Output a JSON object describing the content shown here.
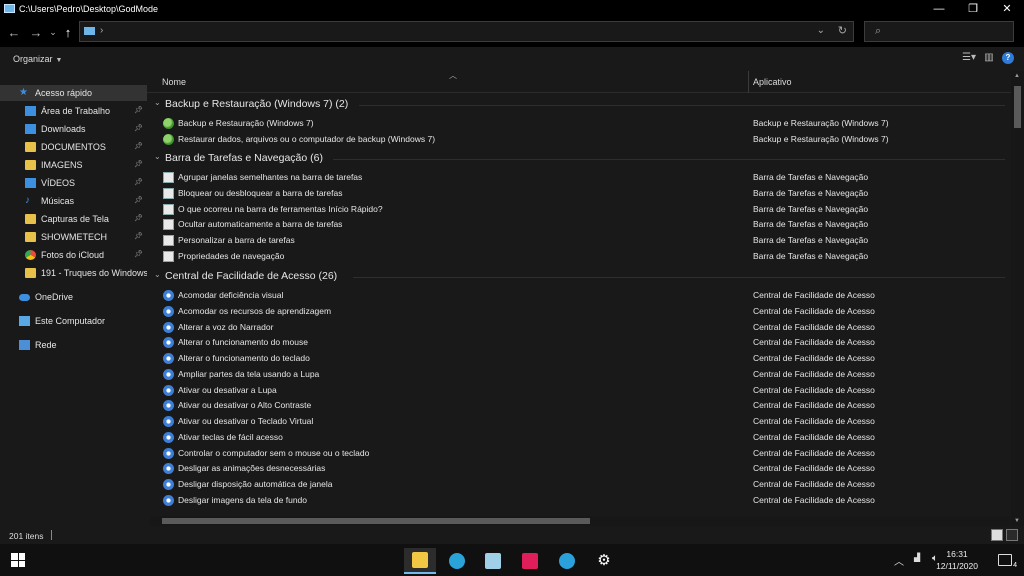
{
  "window": {
    "title": "C:\\Users\\Pedro\\Desktop\\GodMode",
    "minimize": "—",
    "maximize": "❐",
    "close": "✕"
  },
  "nav": {
    "back": "←",
    "forward": "→",
    "recent": "⌄",
    "up": "↑",
    "address_sep": "›",
    "address_dropdown": "⌄",
    "refresh": "↻",
    "search_icon": "⌕"
  },
  "toolbar": {
    "organize": "Organizar"
  },
  "sidebar": {
    "items": [
      {
        "label": "Acesso rápido",
        "icon": "star-icon",
        "pinned": false,
        "selected": true
      },
      {
        "label": "Área de Trabalho",
        "icon": "desktop-icon",
        "pinned": true
      },
      {
        "label": "Downloads",
        "icon": "download-icon",
        "pinned": true
      },
      {
        "label": "DOCUMENTOS",
        "icon": "folder-icon",
        "pinned": true
      },
      {
        "label": "IMAGENS",
        "icon": "folder-icon",
        "pinned": true
      },
      {
        "label": "VÍDEOS",
        "icon": "video-icon",
        "pinned": true
      },
      {
        "label": "Músicas",
        "icon": "music-icon",
        "pinned": true
      },
      {
        "label": "Capturas de Tela",
        "icon": "folder-icon",
        "pinned": true
      },
      {
        "label": "SHOWMETECH",
        "icon": "folder-icon",
        "pinned": true
      },
      {
        "label": "Fotos do iCloud",
        "icon": "chrome-icon",
        "pinned": true
      },
      {
        "label": "191 - Truques do Windows",
        "icon": "folder-icon",
        "pinned": false
      },
      {
        "label": "OneDrive",
        "icon": "cloud-icon",
        "pinned": false
      },
      {
        "label": "Este Computador",
        "icon": "computer-icon",
        "pinned": false
      },
      {
        "label": "Rede",
        "icon": "network-icon",
        "pinned": false
      }
    ]
  },
  "columns": {
    "name": "Nome",
    "app": "Aplicativo"
  },
  "groups": [
    {
      "title": "Backup e Restauração (Windows 7) (2)",
      "icon": "backup-icon",
      "rows": [
        {
          "name": "Backup e Restauração (Windows 7)",
          "app": "Backup e Restauração (Windows 7)"
        },
        {
          "name": "Restaurar dados, arquivos ou o computador de backup (Windows 7)",
          "app": "Backup e Restauração (Windows 7)"
        }
      ]
    },
    {
      "title": "Barra de Tarefas e Navegação (6)",
      "icon": "taskbar-icon",
      "rows": [
        {
          "name": "Agrupar janelas semelhantes na barra de tarefas",
          "app": "Barra de Tarefas e Navegação"
        },
        {
          "name": "Bloquear ou desbloquear a barra de tarefas",
          "app": "Barra de Tarefas e Navegação"
        },
        {
          "name": "O que ocorreu na barra de ferramentas Início Rápido?",
          "app": "Barra de Tarefas e Navegação"
        },
        {
          "name": "Ocultar automaticamente a barra de tarefas",
          "app": "Barra de Tarefas e Navegação"
        },
        {
          "name": "Personalizar a barra de tarefas",
          "app": "Barra de Tarefas e Navegação"
        },
        {
          "name": "Propriedades de navegação",
          "app": "Barra de Tarefas e Navegação"
        }
      ]
    },
    {
      "title": "Central de Facilidade de Acesso (26)",
      "icon": "ease-of-access-icon",
      "rows": [
        {
          "name": "Acomodar deficiência visual",
          "app": "Central de Facilidade de Acesso"
        },
        {
          "name": "Acomodar os recursos de aprendizagem",
          "app": "Central de Facilidade de Acesso"
        },
        {
          "name": "Alterar a voz do Narrador",
          "app": "Central de Facilidade de Acesso"
        },
        {
          "name": "Alterar o funcionamento do mouse",
          "app": "Central de Facilidade de Acesso"
        },
        {
          "name": "Alterar o funcionamento do teclado",
          "app": "Central de Facilidade de Acesso"
        },
        {
          "name": "Ampliar partes da tela usando a Lupa",
          "app": "Central de Facilidade de Acesso"
        },
        {
          "name": "Ativar ou desativar a Lupa",
          "app": "Central de Facilidade de Acesso"
        },
        {
          "name": "Ativar ou desativar o Alto Contraste",
          "app": "Central de Facilidade de Acesso"
        },
        {
          "name": "Ativar ou desativar o Teclado Virtual",
          "app": "Central de Facilidade de Acesso"
        },
        {
          "name": "Ativar teclas de fácil acesso",
          "app": "Central de Facilidade de Acesso"
        },
        {
          "name": "Controlar o computador sem o mouse ou o teclado",
          "app": "Central de Facilidade de Acesso"
        },
        {
          "name": "Desligar as animações desnecessárias",
          "app": "Central de Facilidade de Acesso"
        },
        {
          "name": "Desligar disposição automática de janela",
          "app": "Central de Facilidade de Acesso"
        },
        {
          "name": "Desligar imagens da tela de fundo",
          "app": "Central de Facilidade de Acesso"
        }
      ]
    }
  ],
  "status": {
    "item_count": "201 itens"
  },
  "taskbar": {
    "apps": [
      {
        "name": "file-explorer-icon",
        "color": "#f2c744",
        "active": true
      },
      {
        "name": "edge-icon",
        "color": "#2aa3d8"
      },
      {
        "name": "notepad-icon",
        "color": "#9fd0e8"
      },
      {
        "name": "slack-icon",
        "color": "#e01e5a"
      },
      {
        "name": "telegram-icon",
        "color": "#2aa1da"
      },
      {
        "name": "settings-icon",
        "color": "#ffffff"
      }
    ],
    "time": "16:31",
    "date": "12/11/2020",
    "notifications": "4"
  }
}
